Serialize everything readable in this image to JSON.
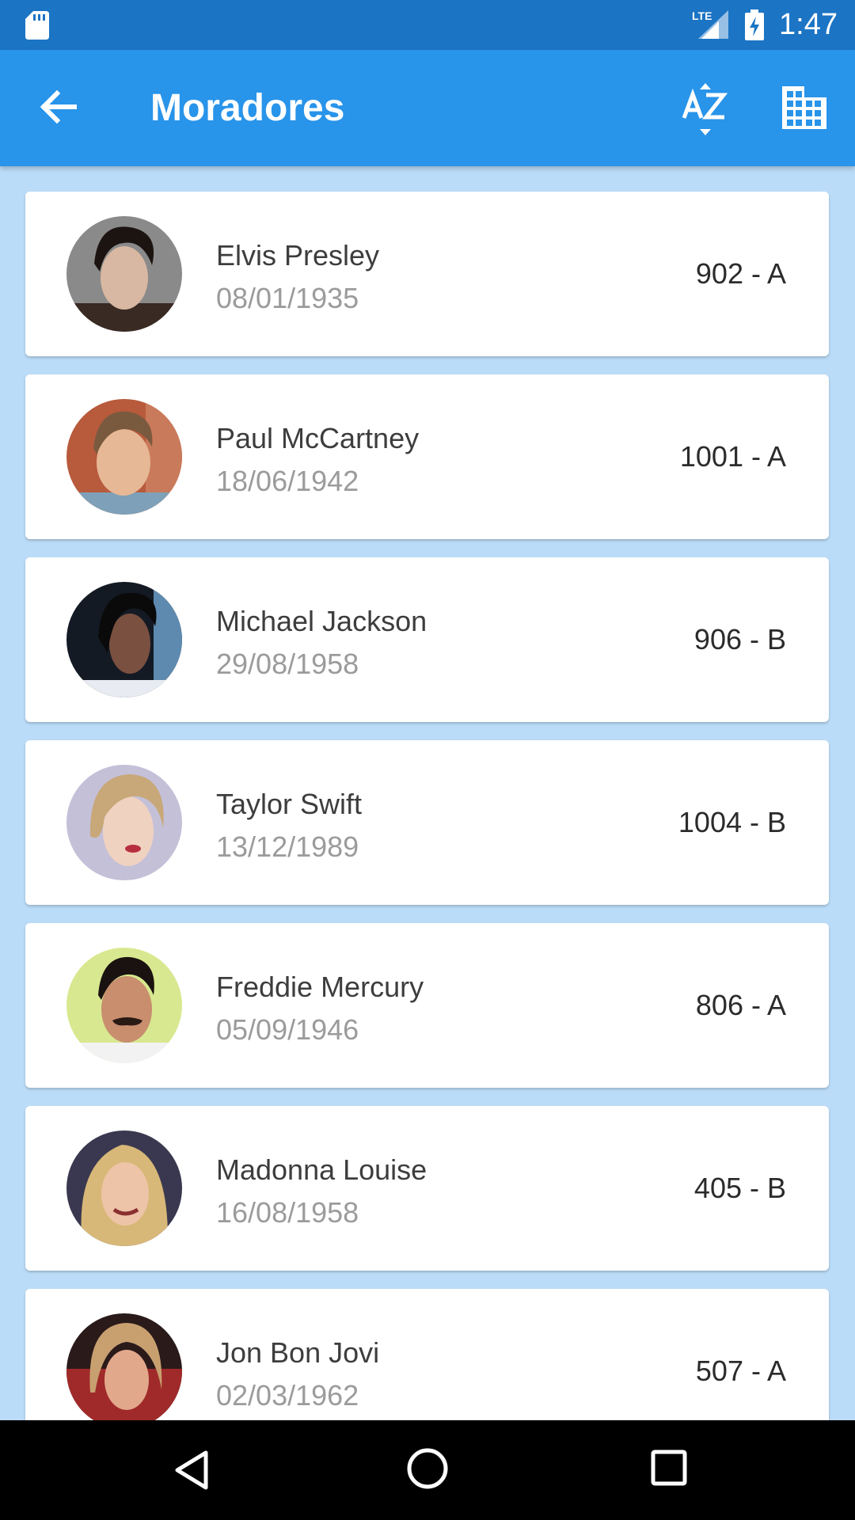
{
  "status_bar": {
    "network_label": "LTE",
    "time": "1:47",
    "icons": [
      "sd-card-icon",
      "signal-lte-icon",
      "battery-charging-icon"
    ]
  },
  "app_bar": {
    "title": "Moradores",
    "icons": [
      "back-arrow-icon",
      "sort-az-icon",
      "building-icon"
    ]
  },
  "colors": {
    "status_bar": "#1b74c4",
    "app_bar": "#2894ea",
    "background": "#bbdcf8",
    "card": "#ffffff",
    "name_text": "#3d3d3d",
    "date_text": "#9b9b9b"
  },
  "residents": [
    {
      "name": "Elvis Presley",
      "birth_date": "08/01/1935",
      "unit": "902 - A"
    },
    {
      "name": "Paul McCartney",
      "birth_date": "18/06/1942",
      "unit": "1001 - A"
    },
    {
      "name": "Michael Jackson",
      "birth_date": "29/08/1958",
      "unit": "906 - B"
    },
    {
      "name": "Taylor Swift",
      "birth_date": "13/12/1989",
      "unit": "1004 - B"
    },
    {
      "name": "Freddie Mercury",
      "birth_date": "05/09/1946",
      "unit": "806 - A"
    },
    {
      "name": "Madonna Louise",
      "birth_date": "16/08/1958",
      "unit": "405 - B"
    },
    {
      "name": "Jon Bon Jovi",
      "birth_date": "02/03/1962",
      "unit": "507 - A"
    }
  ],
  "nav_bar": {
    "icons": [
      "nav-back-icon",
      "nav-home-icon",
      "nav-recents-icon"
    ]
  }
}
